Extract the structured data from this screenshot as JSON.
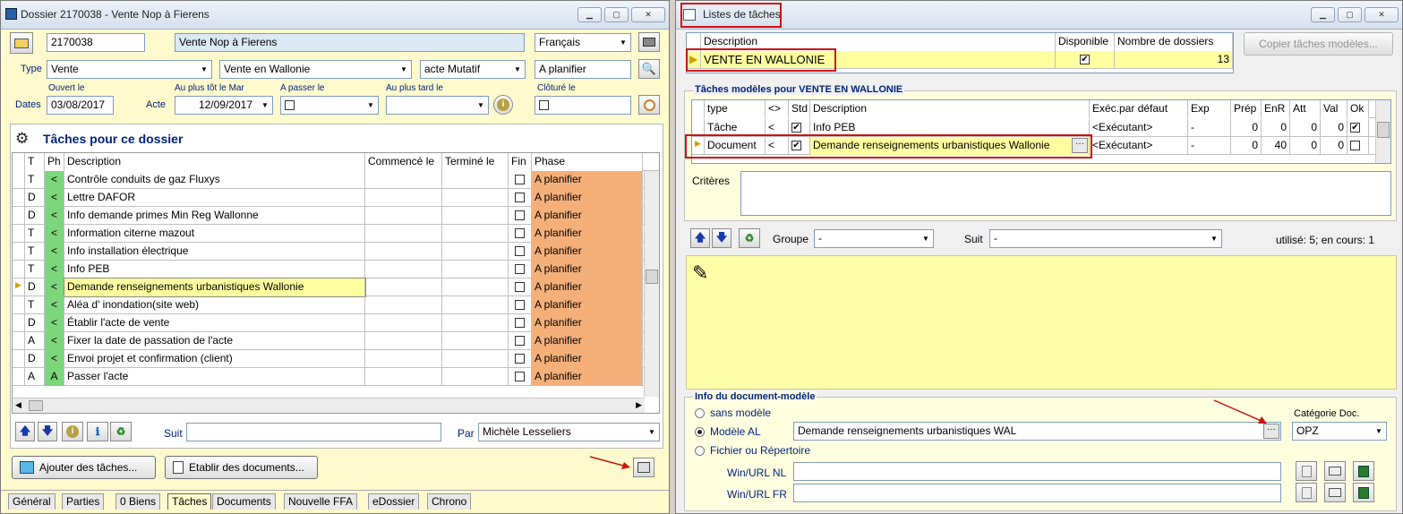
{
  "left": {
    "title": "Dossier 2170038 - Vente Nop à Fierens",
    "dossier_no": "2170038",
    "dossier_name": "Vente Nop à Fierens",
    "language": "Français",
    "type_label": "Type",
    "type": "Vente",
    "subtype": "Vente en Wallonie",
    "acte": "acte Mutatif",
    "status": "A planifier",
    "dates_label": "Dates",
    "opened_label": "Ouvert le",
    "opened": "03/08/2017",
    "acte_label": "Acte",
    "earliest_label": "Au plus tôt le Mar",
    "earliest": "12/09/2017",
    "topass_label": "A passer le",
    "latest_label": "Au plus tard le",
    "closed_label": "Clôturé le",
    "tasks_title": "Tâches pour ce dossier",
    "columns": [
      "T",
      "Ph",
      "Description",
      "Commencé le",
      "Terminé le",
      "Fin",
      "Phase"
    ],
    "rows": [
      {
        "t": "T",
        "ph": "<",
        "desc": "Contrôle conduits de gaz Fluxys",
        "phase": "A planifier"
      },
      {
        "t": "D",
        "ph": "<",
        "desc": "Lettre DAFOR",
        "phase": "A planifier"
      },
      {
        "t": "D",
        "ph": "<",
        "desc": "Info demande primes Min Reg Wallonne",
        "phase": "A planifier"
      },
      {
        "t": "T",
        "ph": "<",
        "desc": "Information citerne mazout",
        "phase": "A planifier"
      },
      {
        "t": "T",
        "ph": "<",
        "desc": "Info installation électrique",
        "phase": "A planifier"
      },
      {
        "t": "T",
        "ph": "<",
        "desc": "Info PEB",
        "phase": "A planifier"
      },
      {
        "t": "D",
        "ph": "<",
        "desc": "Demande renseignements urbanistiques Wallonie",
        "phase": "A planifier"
      },
      {
        "t": "T",
        "ph": "<",
        "desc": "Aléa d' inondation(site web)",
        "phase": "A planifier"
      },
      {
        "t": "D",
        "ph": "<",
        "desc": "Établir l'acte de vente",
        "phase": "A planifier"
      },
      {
        "t": "A",
        "ph": "<",
        "desc": "Fixer la date de passation de l'acte",
        "phase": "A planifier"
      },
      {
        "t": "D",
        "ph": "<",
        "desc": "Envoi projet et confirmation (client)",
        "phase": "A planifier"
      },
      {
        "t": "A",
        "ph": "A",
        "desc": "Passer l'acte",
        "phase": "A planifier"
      }
    ],
    "suit_label": "Suit",
    "par_label": "Par",
    "par_value": "Michèle Lesseliers",
    "add_tasks": "Ajouter des tâches...",
    "make_docs": "Etablir des documents...",
    "tabs": [
      "Général",
      "Parties",
      "0 Biens",
      "Tâches",
      "Documents",
      "Nouvelle FFA",
      "eDossier",
      "Chrono"
    ]
  },
  "right": {
    "title": "Listes de tâches",
    "list_columns": [
      "Description",
      "Disponible",
      "Nombre de dossiers"
    ],
    "list_row": {
      "desc": "VENTE EN WALLONIE",
      "count": "13"
    },
    "copy_btn": "Copier tâches modèles...",
    "models_title": "Tâches modèles pour VENTE EN WALLONIE",
    "model_columns": [
      "type",
      "<>",
      "Std",
      "Description",
      "Exéc.par défaut",
      "Exp",
      "Prép",
      "EnR",
      "Att",
      "Val",
      "Ok"
    ],
    "model_rows": [
      {
        "type": "Tâche",
        "lt": "<",
        "desc": "Info PEB",
        "exec": "<Exécutant>",
        "exp": "-",
        "prep": "0",
        "enr": "0",
        "att": "0",
        "val": "0"
      },
      {
        "type": "Document",
        "lt": "<",
        "desc": "Demande renseignements urbanistiques Wallonie",
        "exec": "<Exécutant>",
        "exp": "-",
        "prep": "0",
        "enr": "40",
        "att": "0",
        "val": "0"
      }
    ],
    "criteres_label": "Critères",
    "groupe_label": "Groupe",
    "groupe_value": "-",
    "suit_label": "Suit",
    "suit_value": "-",
    "usage": "utilisé: 5; en cours: 1",
    "docinfo_title": "Info du document-modèle",
    "opt_none": "sans modèle",
    "opt_model": "Modèle AL",
    "model_value": "Demande renseignements urbanistiques WAL",
    "cat_label": "Catégorie Doc.",
    "cat_value": "OPZ",
    "opt_file": "Fichier ou Répertoire",
    "url_nl": "Win/URL NL",
    "url_fr": "Win/URL FR"
  }
}
